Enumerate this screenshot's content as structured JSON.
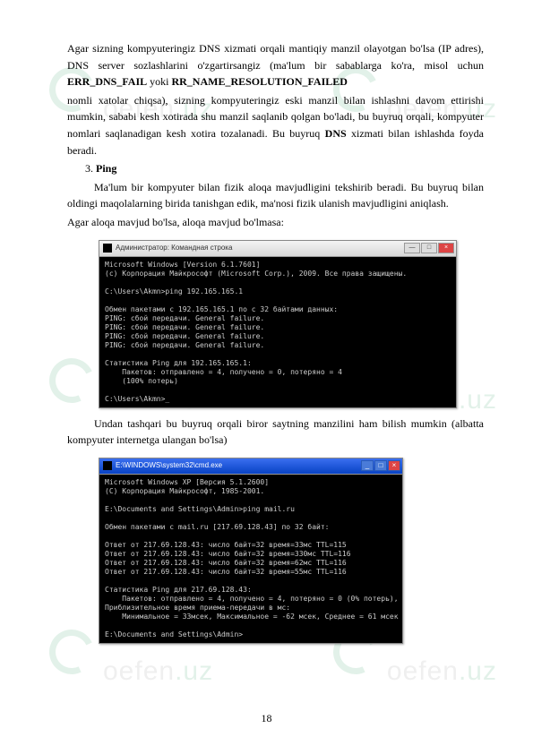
{
  "watermark_text_main": "oefen",
  "watermark_text_suffix": ".uz",
  "para1": "Agar sizning kompyuteringiz DNS xizmati orqali mantiqiy manzil olayotgan bo'lsa (IP adres), DNS server sozlashlarini o'zgartirsangiz (ma'lum bir sabablarga ko'ra, misol uchun ",
  "err1": "ERR_DNS_FAIL",
  "para1b": " yoki ",
  "err2": "RR_NAME_RESOLUTION_FAILED",
  "para2": "nomli xatolar chiqsa), sizning kompyuteringiz eski manzil bilan ishlashni davom ettirishi mumkin, sababi kesh xotirada shu manzil saqlanib qolgan bo'ladi, bu buyruq orqali, kompyuter nomlari saqlanadigan kesh xotira tozalanadi. Bu buyruq ",
  "dns_bold": "DNS",
  "para2b": " xizmati bilan ishlashda foyda beradi.",
  "list3_num": "3. ",
  "list3_title": "Ping",
  "para3": "Ma'lum bir kompyuter bilan fizik aloqa mavjudligini tekshirib beradi. Bu buyruq bilan oldingi maqolalarning birida tanishgan edik, ma'nosi fizik ulanish mavjudligini aniqlash.",
  "para4": "Agar aloqa mavjud bo'lsa, aloqa mavjud bo'lmasa:",
  "terminal1": {
    "title": "Администратор: Командная строка",
    "content": "Microsoft Windows [Version 6.1.7601]\n(c) Корпорация Майкрософт (Microsoft Corp.), 2009. Все права защищены.\n\nC:\\Users\\Akmn>ping 192.165.165.1\n\nОбмен пакетами с 192.165.165.1 по с 32 байтами данных:\nPING: сбой передачи. General failure.\nPING: сбой передачи. General failure.\nPING: сбой передачи. General failure.\nPING: сбой передачи. General failure.\n\nСтатистика Ping для 192.165.165.1:\n    Пакетов: отправлено = 4, получено = 0, потеряно = 4\n    (100% потерь)\n\nC:\\Users\\Akmn>_"
  },
  "para5": "Undan tashqari bu buyruq orqali biror saytning manzilini ham bilish mumkin (albatta kompyuter internetga ulangan bo'lsa)",
  "terminal2": {
    "title": "E:\\WINDOWS\\system32\\cmd.exe",
    "content": "Microsoft Windows XP [Версия 5.1.2600]\n(С) Корпорация Майкрософт, 1985-2001.\n\nE:\\Documents and Settings\\Admin>ping mail.ru\n\nОбмен пакетами с mail.ru [217.69.128.43] по 32 байт:\n\nОтвет от 217.69.128.43: число байт=32 время=33мс TTL=115\nОтвет от 217.69.128.43: число байт=32 время=330мс TTL=116\nОтвет от 217.69.128.43: число байт=32 время=62мс TTL=116\nОтвет от 217.69.128.43: число байт=32 время=55мс TTL=116\n\nСтатистика Ping для 217.69.128.43:\n    Пакетов: отправлено = 4, получено = 4, потеряно = 0 (0% потерь),\nПриблизительное время приема-передачи в мс:\n    Минимальное = 33мсек, Максимальное = -62 мсек, Среднее = 61 мсек\n\nE:\\Documents and Settings\\Admin>"
  },
  "page_number": "18"
}
